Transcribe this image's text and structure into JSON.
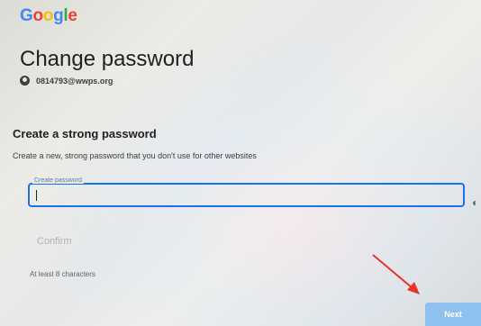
{
  "header": {
    "logo": [
      "G",
      "o",
      "o",
      "g",
      "l",
      "e"
    ],
    "title": "Change password"
  },
  "account": {
    "icon": "account-circle-icon",
    "email": "0814793@wwps.org"
  },
  "form": {
    "heading": "Create a strong password",
    "description": "Create a new, strong password that you don't use for other websites",
    "password_label": "Create password",
    "password_value": "",
    "show_password_icon": "eye-icon",
    "confirm_label": "Confirm",
    "hint": "At least 8 characters",
    "next_label": "Next"
  },
  "annotation": {
    "arrow": "red-arrow-pointer",
    "color": "#e8322a"
  },
  "colors": {
    "accent": "#1a73e8",
    "next_button": "#8fc1ef"
  }
}
